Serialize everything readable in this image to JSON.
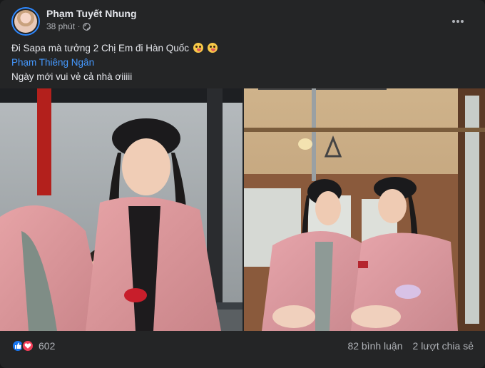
{
  "post": {
    "author": "Phạm Tuyết Nhung",
    "time": "38 phút",
    "separator": "·",
    "privacy_icon": "globe-icon",
    "menu_icon": "more-horizontal-icon",
    "text_line1": "Đi Sapa mà tưởng 2 Chị Em đi Hàn Quốc",
    "text_emojis": [
      "winking-tongue-emoji",
      "winking-tongue-emoji"
    ],
    "mention": "Phạm Thiêng Ngân",
    "text_line3": "Ngày mới vui vẻ cả nhà ơiiiii"
  },
  "photos": [
    {
      "name": "photo-cable-car-selfie"
    },
    {
      "name": "photo-train-carriage"
    }
  ],
  "stats": {
    "reaction_icons": [
      "like-icon",
      "love-icon"
    ],
    "reaction_count": "602",
    "comments": "82 bình luận",
    "shares": "2 lượt chia sẻ"
  },
  "colors": {
    "card_bg": "#242526",
    "text": "#e4e6eb",
    "secondary_text": "#b0b3b8",
    "link": "#4599ff",
    "like": "#1877f2",
    "love": "#f33e58"
  }
}
